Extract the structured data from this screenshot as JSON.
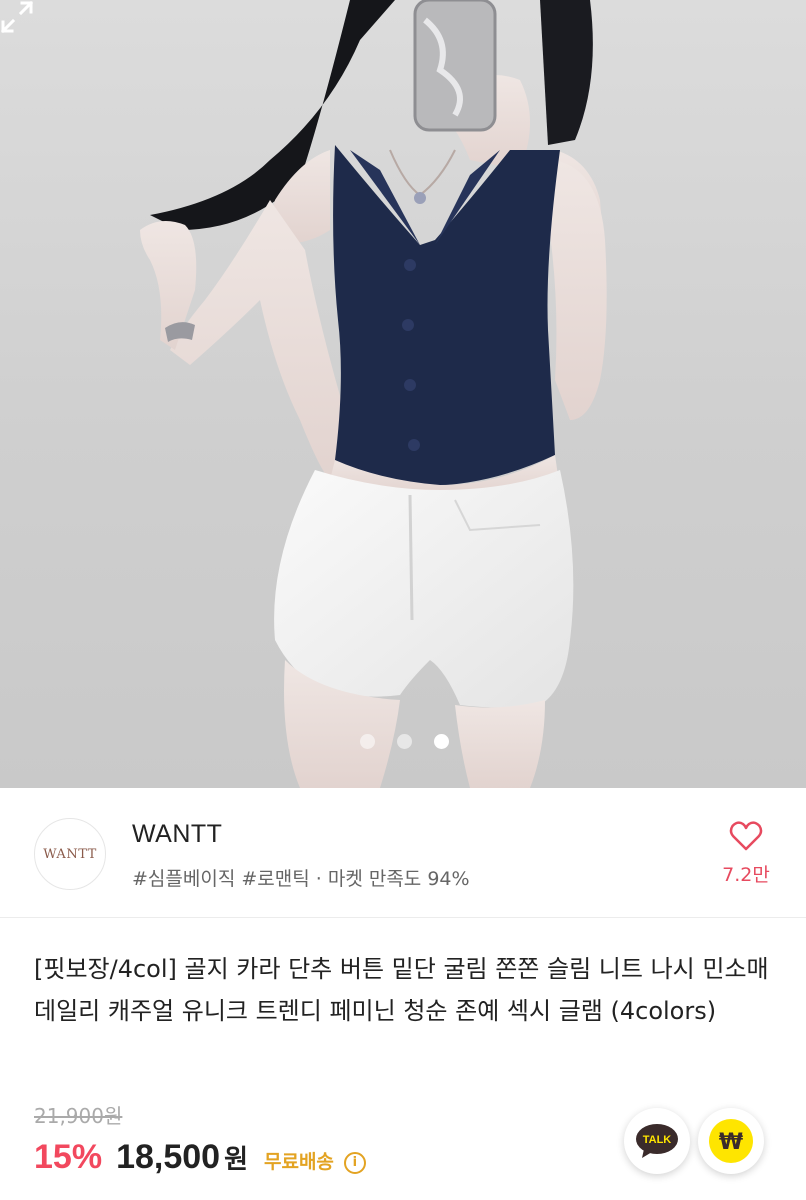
{
  "gallery": {
    "total_slides": 3,
    "active_slide": 3,
    "expand_icon": "expand-icon"
  },
  "store": {
    "logo_text": "WANTT",
    "name": "WANTT",
    "tags": "#심플베이직 #로맨틱 · 마켓 만족도 94%",
    "like_icon": "heart-outline-icon",
    "like_count": "7.2만"
  },
  "product": {
    "title": "[핏보장/4col] 골지 카라 단추 버튼 밑단 굴림 쫀쫀 슬림 니트 나시 민소매 데일리 캐주얼 유니크 트렌디 페미닌 청순 존예 섹시 글램 (4colors)",
    "original_price": "21,900원",
    "discount": "15%",
    "price": "18,500",
    "currency": "원",
    "shipping": "무료배송",
    "info_icon": "info-icon"
  },
  "actions": {
    "talk_label": "TALK",
    "pay_label": "₩"
  },
  "colors": {
    "discount": "#f2485e",
    "shipping": "#e3a322",
    "kakao_yellow": "#fee500",
    "like": "#e74a5f"
  }
}
